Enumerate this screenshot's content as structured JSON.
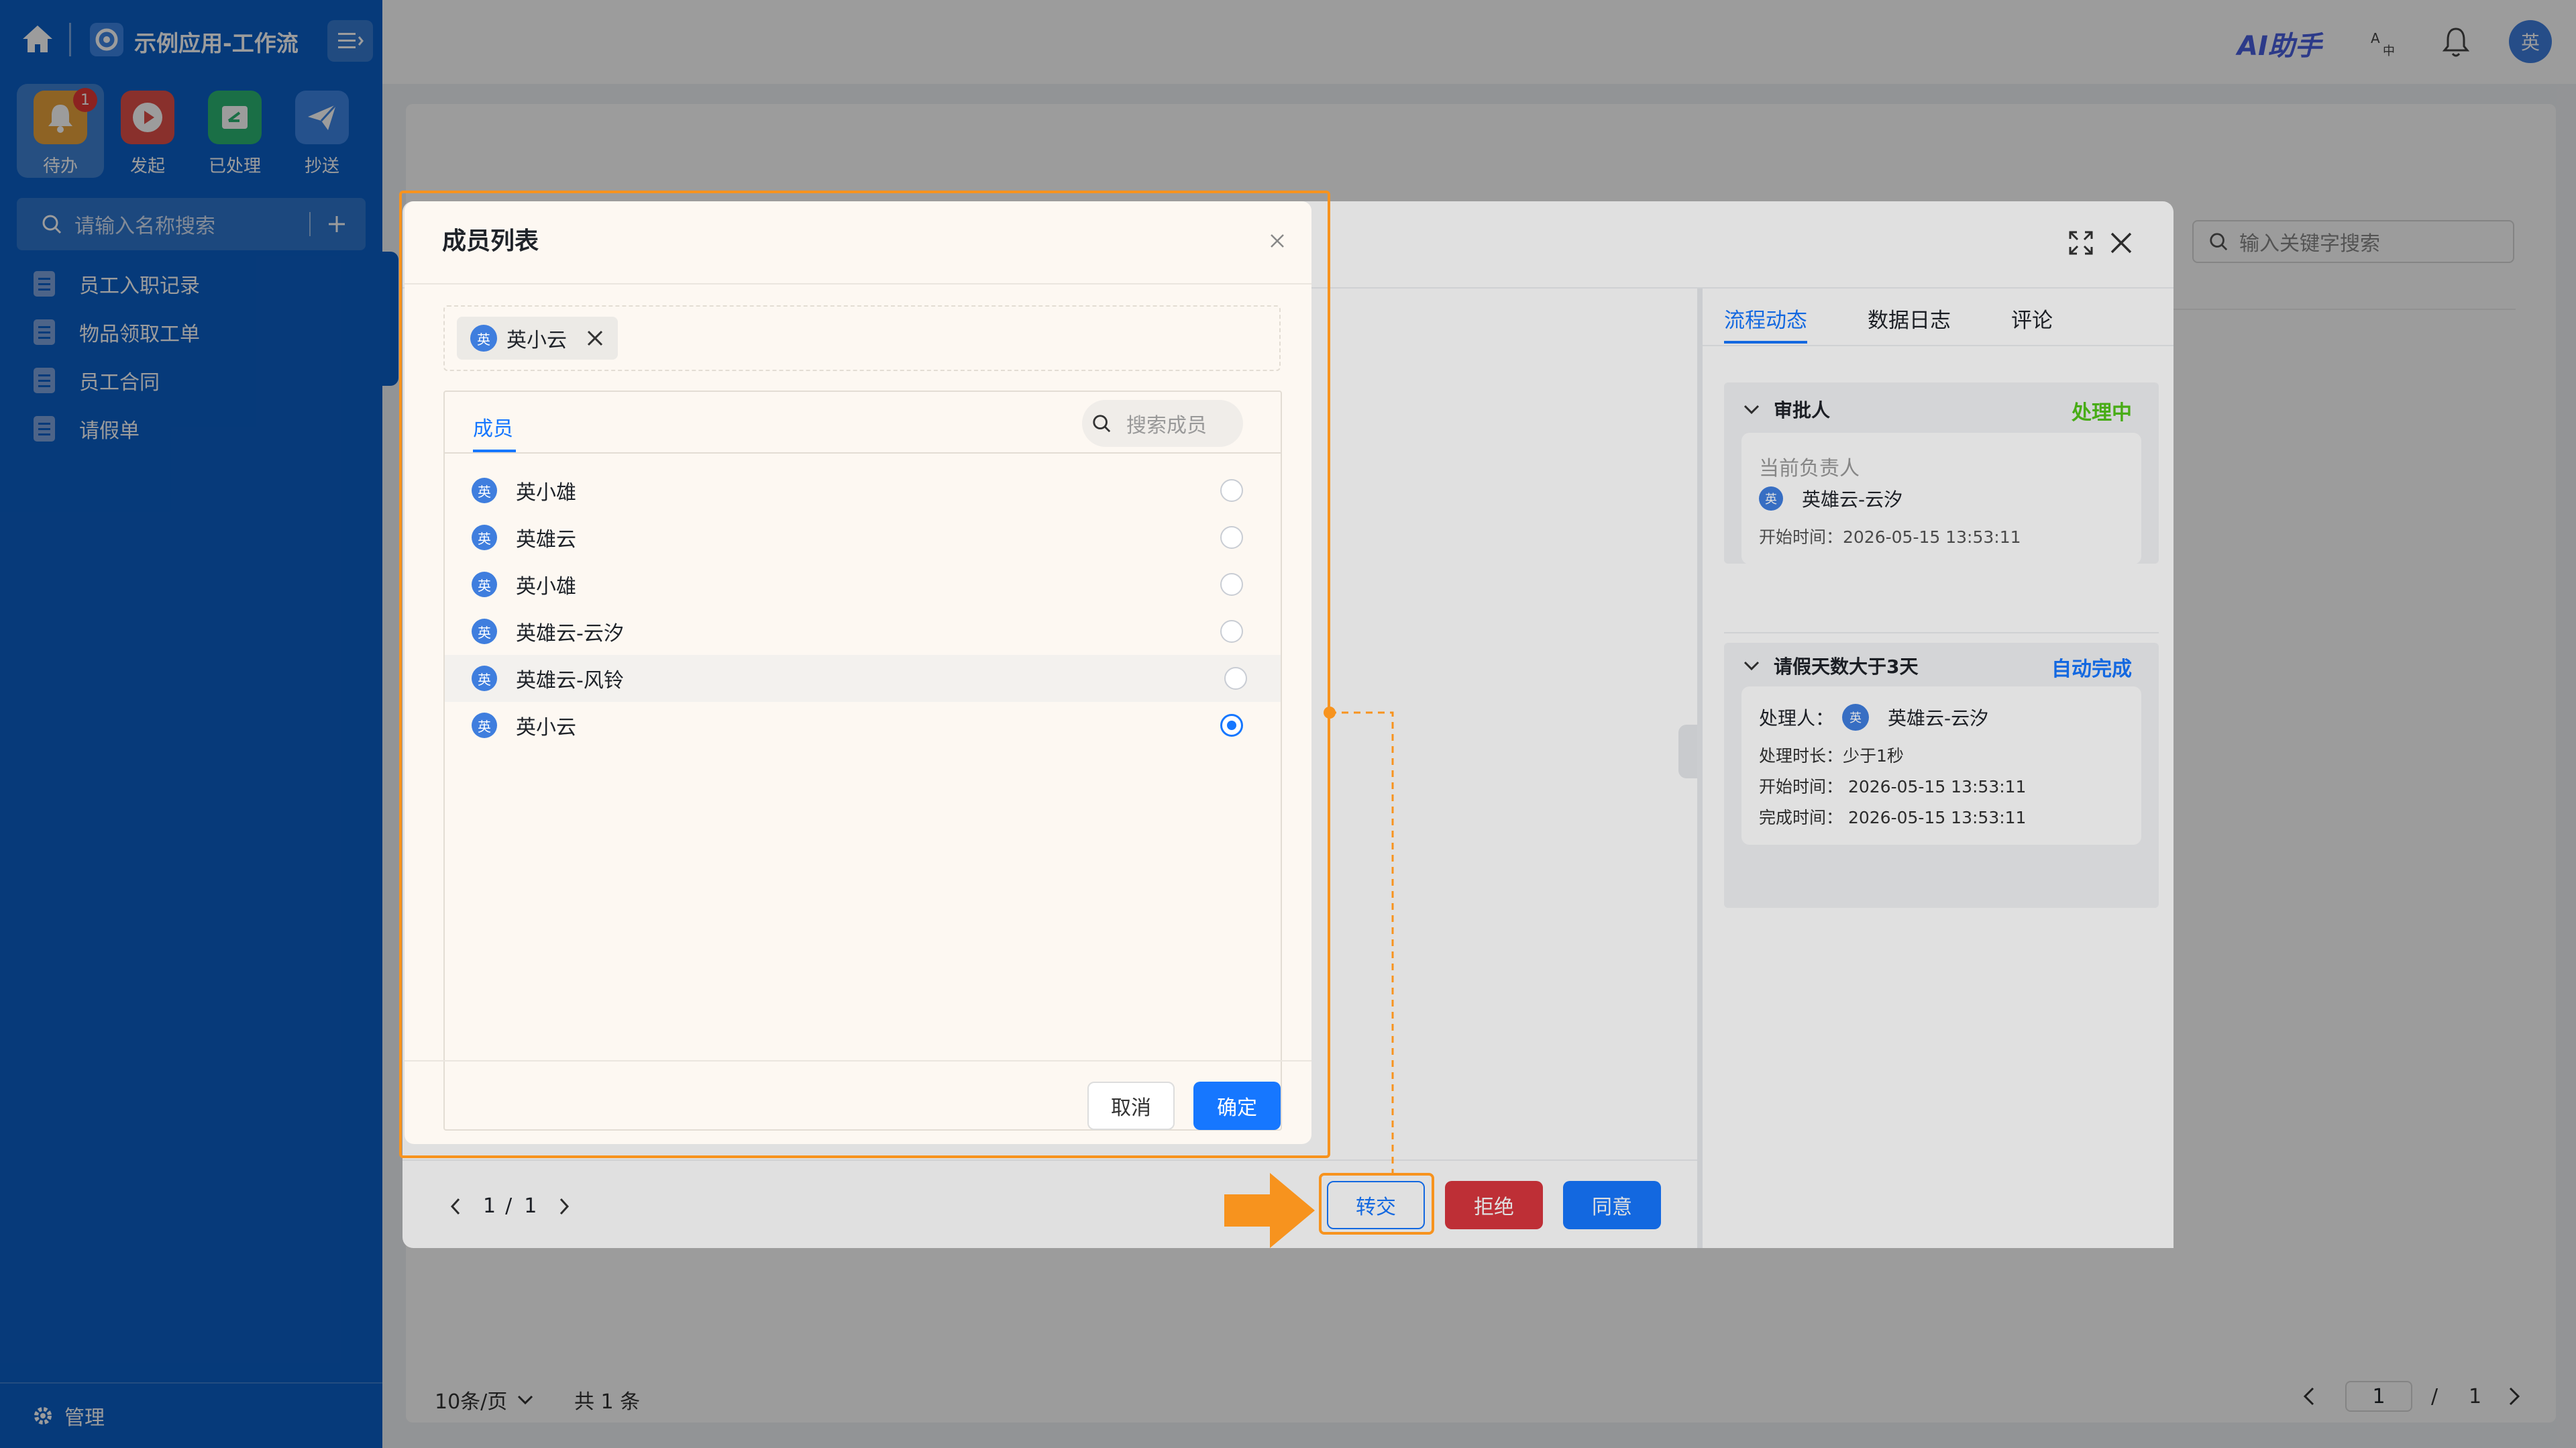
{
  "sidebar": {
    "app_title": "示例应用-工作流",
    "nav": [
      {
        "label": "待办",
        "badge": "1",
        "icon": "bell-icon",
        "color": "#e8a33d"
      },
      {
        "label": "发起",
        "icon": "play-icon",
        "color": "#e0504a"
      },
      {
        "label": "已处理",
        "icon": "check-doc-icon",
        "color": "#2bb673"
      },
      {
        "label": "抄送",
        "icon": "paper-plane-icon",
        "color": "#3e86e6"
      }
    ],
    "search_placeholder": "请输入名称搜索",
    "menu": [
      "员工入职记录",
      "物品领取工单",
      "员工合同",
      "请假单"
    ],
    "footer_label": "管理"
  },
  "topbar": {
    "ai_label": "AI助手",
    "user_avatar": "英"
  },
  "background_page": {
    "search_placeholder": "输入关键字搜索",
    "page_size": "10条/页",
    "total": "共 1 条",
    "page_current": "1",
    "page_sep": "/",
    "page_total": "1"
  },
  "main_dialog": {
    "tabs": [
      "流程动态",
      "数据日志",
      "评论"
    ],
    "active_tab": 0,
    "approver_section": {
      "title": "审批人",
      "status": "处理中",
      "status_color": "#52c41a",
      "card_label": "当前负责人",
      "person": "英雄云-云汐",
      "avatar": "英",
      "start_time": "开始时间：2026-05-15 13:53:11"
    },
    "auto_section": {
      "title": "请假天数大于3天",
      "status": "自动完成",
      "status_color": "#1677ff",
      "handler_label": "处理人：",
      "person": "英雄云-云汐",
      "avatar": "英",
      "duration": "处理时长：少于1秒",
      "start_time": "开始时间：  2026-05-15 13:53:11",
      "finish_time": "完成时间：  2026-05-15 13:53:11"
    },
    "pager": {
      "current": "1",
      "sep": "/",
      "total": "1"
    },
    "buttons": {
      "transfer": "转交",
      "reject": "拒绝",
      "approve": "同意"
    }
  },
  "member_dialog": {
    "title": "成员列表",
    "selected_tag": {
      "avatar": "英",
      "name": "英小云"
    },
    "tab": "成员",
    "search_placeholder": "搜索成员",
    "members": [
      {
        "avatar": "英",
        "name": "英小雄",
        "selected": false
      },
      {
        "avatar": "英",
        "name": "英雄云",
        "selected": false
      },
      {
        "avatar": "英",
        "name": "英小雄",
        "selected": false
      },
      {
        "avatar": "英",
        "name": "英雄云-云汐",
        "selected": false
      },
      {
        "avatar": "英",
        "name": "英雄云-风铃",
        "selected": false
      },
      {
        "avatar": "英",
        "name": "英小云",
        "selected": true
      }
    ],
    "cancel": "取消",
    "confirm": "确定"
  },
  "colors": {
    "sidebar": "#0b5fc7",
    "primary": "#1677ff",
    "danger": "#d9363e",
    "highlight": "#f7931e"
  }
}
